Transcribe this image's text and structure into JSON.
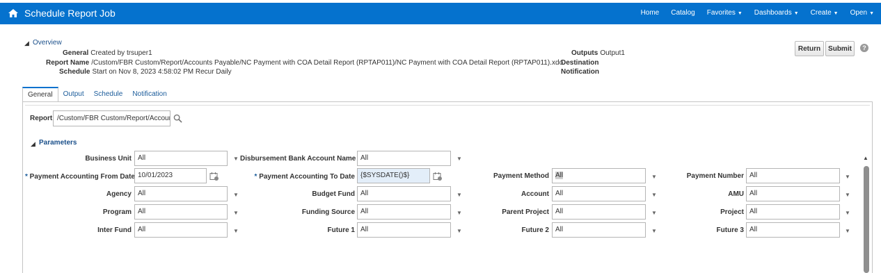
{
  "header": {
    "title": "Schedule Report Job",
    "nav": [
      {
        "label": "Home",
        "dropdown": false
      },
      {
        "label": "Catalog",
        "dropdown": false
      },
      {
        "label": "Favorites",
        "dropdown": true
      },
      {
        "label": "Dashboards",
        "dropdown": true
      },
      {
        "label": "Create",
        "dropdown": true
      },
      {
        "label": "Open",
        "dropdown": true
      }
    ]
  },
  "overview": {
    "title": "Overview",
    "general_label": "General",
    "general_value": "Created by trsuper1",
    "report_name_label": "Report Name",
    "report_name_value": "/Custom/FBR Custom/Report/Accounts Payable/NC Payment with COA Detail Report (RPTAP011)/NC Payment with COA Detail Report (RPTAP011).xdo",
    "schedule_label": "Schedule",
    "schedule_value": "Start on Nov 8, 2023 4:58:02 PM Recur Daily",
    "outputs_label": "Outputs",
    "outputs_value": "Output1",
    "destination_label": "Destination",
    "notification_label": "Notification"
  },
  "buttons": {
    "return": "Return",
    "submit": "Submit",
    "help": "?"
  },
  "tabs": [
    "General",
    "Output",
    "Schedule",
    "Notification"
  ],
  "report": {
    "label": "Report",
    "value": "/Custom/FBR Custom/Report/Accoun"
  },
  "parameters": {
    "title": "Parameters",
    "business_unit": {
      "label": "Business Unit",
      "value": "All"
    },
    "disbursement_bank": {
      "label": "Disbursement Bank Account Name",
      "value": "All"
    },
    "accounting_from": {
      "label": "Payment Accounting From Date",
      "value": "10/01/2023"
    },
    "accounting_to": {
      "label": "Payment Accounting To Date",
      "value": "{$SYSDATE()$}"
    },
    "payment_method": {
      "label": "Payment Method",
      "value": "All"
    },
    "payment_number": {
      "label": "Payment Number",
      "value": "All"
    },
    "agency": {
      "label": "Agency",
      "value": "All"
    },
    "budget_fund": {
      "label": "Budget Fund",
      "value": "All"
    },
    "account": {
      "label": "Account",
      "value": "All"
    },
    "amu": {
      "label": "AMU",
      "value": "All"
    },
    "program": {
      "label": "Program",
      "value": "All"
    },
    "funding_source": {
      "label": "Funding Source",
      "value": "All"
    },
    "parent_project": {
      "label": "Parent Project",
      "value": "All"
    },
    "project": {
      "label": "Project",
      "value": "All"
    },
    "inter_fund": {
      "label": "Inter Fund",
      "value": "All"
    },
    "future1": {
      "label": "Future 1",
      "value": "All"
    },
    "future2": {
      "label": "Future 2",
      "value": "All"
    },
    "future3": {
      "label": "Future 3",
      "value": "All"
    }
  },
  "colors": {
    "header": "#0572ce",
    "link": "#1a5b9a"
  }
}
